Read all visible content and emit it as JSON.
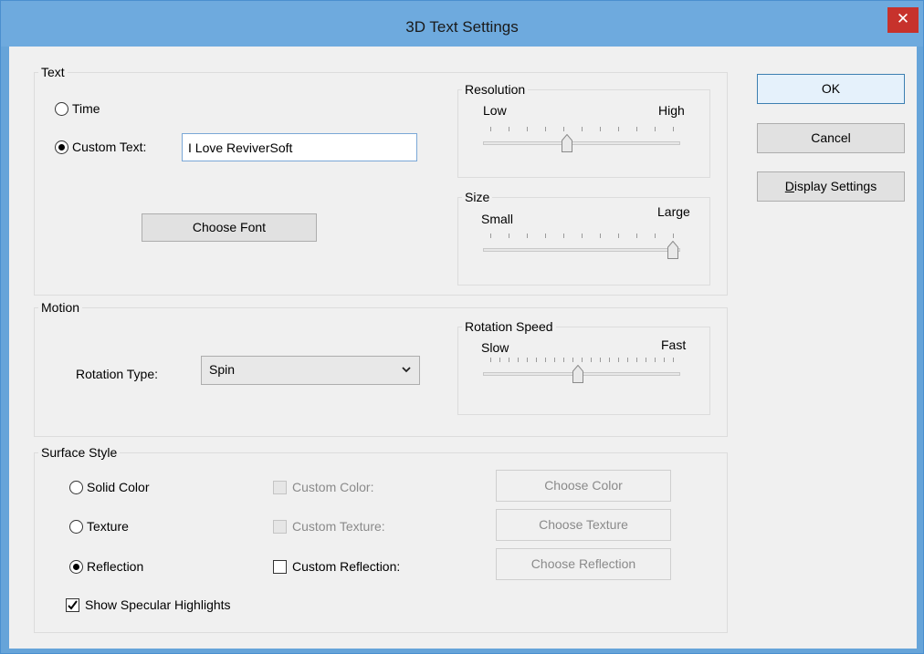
{
  "window": {
    "title": "3D Text Settings",
    "close_glyph": "✕"
  },
  "text_group": {
    "label": "Text",
    "time_label": "Time",
    "custom_text_label": "Custom Text:",
    "custom_text_value": "I Love ReviverSoft",
    "choose_font_label": "Choose Font",
    "selected": "custom_text"
  },
  "resolution": {
    "label": "Resolution",
    "min_label": "Low",
    "max_label": "High",
    "level": 0.42,
    "ticks": 11
  },
  "size": {
    "label": "Size",
    "min_label": "Small",
    "max_label": "Large",
    "level": 1.0,
    "ticks": 11
  },
  "motion_group": {
    "label": "Motion",
    "rotation_type_label": "Rotation Type:",
    "rotation_type_value": "Spin"
  },
  "rotation_speed": {
    "label": "Rotation Speed",
    "min_label": "Slow",
    "max_label": "Fast",
    "level": 0.48,
    "ticks": 21
  },
  "surface_group": {
    "label": "Surface Style",
    "solid_color_label": "Solid Color",
    "texture_label": "Texture",
    "reflection_label": "Reflection",
    "selected": "reflection",
    "custom_color_label": "Custom Color:",
    "custom_texture_label": "Custom Texture:",
    "custom_reflection_label": "Custom Reflection:",
    "custom_reflection_checked": false,
    "choose_color_label": "Choose Color",
    "choose_texture_label": "Choose Texture",
    "choose_reflection_label": "Choose Reflection",
    "specular_label": "Show Specular Highlights",
    "specular_checked": true
  },
  "buttons": {
    "ok": "OK",
    "cancel": "Cancel",
    "display_settings_access": "D",
    "display_settings_rest": "isplay Settings"
  },
  "icons": {
    "dropdown": "chevron-down-icon",
    "close": "close-icon",
    "checkmark": "checkmark-icon"
  },
  "colors": {
    "title_bar": "#6eaade",
    "close_button": "#c7322c",
    "dialog_bg": "#f0f0f0",
    "input_border": "#7aa7d6"
  }
}
